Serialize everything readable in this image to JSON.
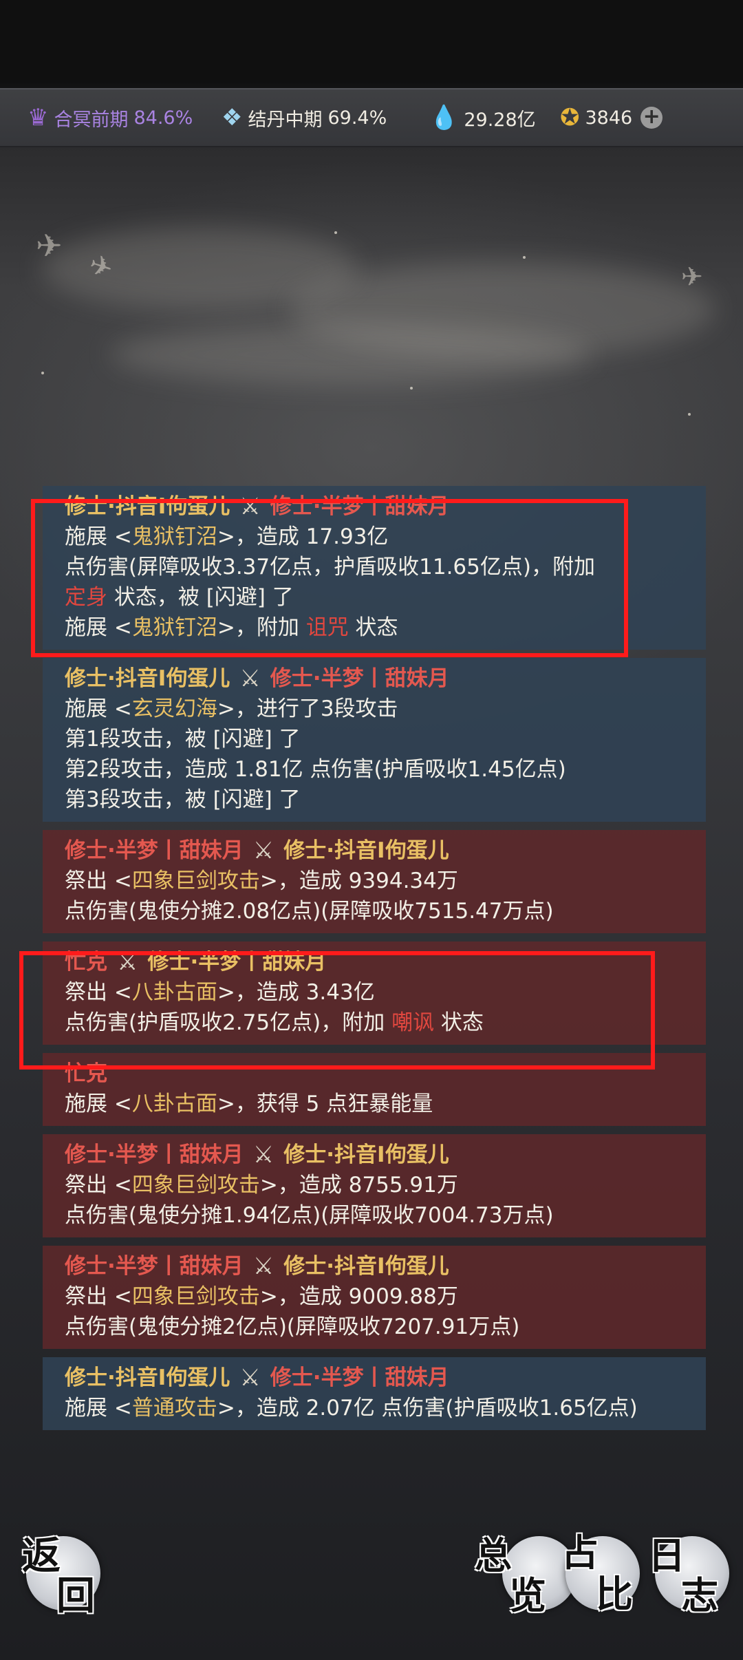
{
  "status_bar": {
    "realm1": {
      "name": "合冥前期",
      "pct": "84.6%"
    },
    "realm2": {
      "name": "结丹中期",
      "pct": "69.4%"
    },
    "spirit_stones": "29.28亿",
    "jade": "3846"
  },
  "log": {
    "entries": [
      {
        "theme": "blue",
        "attacker": "修士·抖音I佝蛋儿",
        "defender": "修士·半梦丨甜妹月",
        "lines": [
          {
            "pre": "施展 <",
            "skill": "鬼狱钉沼",
            "post": ">，造成 17.93亿"
          },
          {
            "text": "点伤害(屏障吸收3.37亿点，护盾吸收11.65亿点)，附加"
          },
          {
            "debuff": "定身",
            "post": " 状态，被 [闪避] 了"
          },
          {
            "pre": "施展 <",
            "skill": "鬼狱钉沼",
            "post": ">，附加 ",
            "debuff": "诅咒",
            "post2": " 状态"
          }
        ]
      },
      {
        "theme": "blue",
        "attacker": "修士·抖音I佝蛋儿",
        "defender": "修士·半梦丨甜妹月",
        "lines": [
          {
            "pre": "施展 <",
            "skill": "玄灵幻海",
            "post": ">，进行了3段攻击"
          },
          {
            "text": "第1段攻击，被 [闪避] 了"
          },
          {
            "text": "第2段攻击，造成 1.81亿 点伤害(护盾吸收1.45亿点)"
          },
          {
            "text": "第3段攻击，被 [闪避] 了"
          }
        ]
      },
      {
        "theme": "red",
        "attacker": "修士·半梦丨甜妹月",
        "defender": "修士·抖音I佝蛋儿",
        "lines": [
          {
            "pre": "祭出 <",
            "skill": "四象巨剑攻击",
            "post": ">，造成 9394.34万"
          },
          {
            "text": "点伤害(鬼使分摊2.08亿点)(屏障吸收7515.47万点)"
          }
        ]
      },
      {
        "theme": "red",
        "attacker": "忙克",
        "defender": "修士·半梦丨甜妹月",
        "lines": [
          {
            "pre": "祭出 <",
            "skill": "八卦古面",
            "post": ">，造成 3.43亿"
          },
          {
            "pre": "点伤害(护盾吸收2.75亿点)，附加 ",
            "debuff": "嘲讽",
            "post": " 状态"
          }
        ]
      },
      {
        "theme": "red",
        "attacker": "忙克",
        "defender": "",
        "lines": [
          {
            "pre": "施展 <",
            "skill": "八卦古面",
            "post": ">，获得 5 点狂暴能量"
          }
        ]
      },
      {
        "theme": "red",
        "attacker": "修士·半梦丨甜妹月",
        "defender": "修士·抖音I佝蛋儿",
        "lines": [
          {
            "pre": "祭出 <",
            "skill": "四象巨剑攻击",
            "post": ">，造成 8755.91万"
          },
          {
            "text": "点伤害(鬼使分摊1.94亿点)(屏障吸收7004.73万点)"
          }
        ]
      },
      {
        "theme": "red",
        "attacker": "修士·半梦丨甜妹月",
        "defender": "修士·抖音I佝蛋儿",
        "lines": [
          {
            "pre": "祭出 <",
            "skill": "四象巨剑攻击",
            "post": ">，造成 9009.88万"
          },
          {
            "text": "点伤害(鬼使分摊2亿点)(屏障吸收7207.91万点)"
          }
        ]
      },
      {
        "theme": "blue",
        "attacker": "修士·抖音I佝蛋儿",
        "defender": "修士·半梦丨甜妹月",
        "lines": [
          {
            "pre": "施展 <",
            "skill": "普通攻击",
            "post": ">，造成 2.07亿 点伤害(护盾吸收1.65亿点)"
          }
        ]
      }
    ]
  },
  "buttons": {
    "back": [
      "返",
      "回"
    ],
    "overview": [
      "总",
      "览"
    ],
    "ratio": [
      "占",
      "比"
    ],
    "log": [
      "日",
      "志"
    ]
  },
  "colors": {
    "gold": "#e9c064",
    "pink": "#e4584f",
    "debuff": "#e1473f",
    "highlight": "#ff1b1b"
  }
}
